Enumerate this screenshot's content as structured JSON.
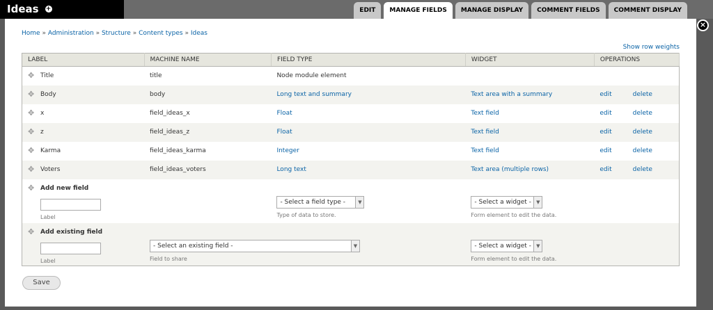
{
  "header": {
    "title": "Ideas",
    "tabs": [
      {
        "label": "EDIT",
        "active": false
      },
      {
        "label": "MANAGE FIELDS",
        "active": true
      },
      {
        "label": "MANAGE DISPLAY",
        "active": false
      },
      {
        "label": "COMMENT FIELDS",
        "active": false
      },
      {
        "label": "COMMENT DISPLAY",
        "active": false
      }
    ]
  },
  "breadcrumb": {
    "items": [
      "Home",
      "Administration",
      "Structure",
      "Content types",
      "Ideas"
    ],
    "separator": "»"
  },
  "show_row_weights": "Show row weights",
  "table": {
    "headers": [
      "LABEL",
      "MACHINE NAME",
      "FIELD TYPE",
      "WIDGET",
      "OPERATIONS"
    ],
    "rows": [
      {
        "label": "Title",
        "machine": "title",
        "type": "Node module element",
        "widget": "",
        "edit": "",
        "delete": ""
      },
      {
        "label": "Body",
        "machine": "body",
        "type": "Long text and summary",
        "widget": "Text area with a summary",
        "edit": "edit",
        "delete": "delete"
      },
      {
        "label": "x",
        "machine": "field_ideas_x",
        "type": "Float",
        "widget": "Text field",
        "edit": "edit",
        "delete": "delete"
      },
      {
        "label": "z",
        "machine": "field_ideas_z",
        "type": "Float",
        "widget": "Text field",
        "edit": "edit",
        "delete": "delete"
      },
      {
        "label": "Karma",
        "machine": "field_ideas_karma",
        "type": "Integer",
        "widget": "Text field",
        "edit": "edit",
        "delete": "delete"
      },
      {
        "label": "Voters",
        "machine": "field_ideas_voters",
        "type": "Long text",
        "widget": "Text area (multiple rows)",
        "edit": "edit",
        "delete": "delete"
      }
    ]
  },
  "add_new": {
    "title": "Add new field",
    "label_value": "",
    "label_caption": "Label",
    "type_select": "- Select a field type -",
    "type_caption": "Type of data to store.",
    "widget_select": "- Select a widget -",
    "widget_caption": "Form element to edit the data."
  },
  "add_existing": {
    "title": "Add existing field",
    "label_value": "",
    "label_caption": "Label",
    "field_select": "- Select an existing field -",
    "field_caption": "Field to share",
    "widget_select": "- Select a widget -",
    "widget_caption": "Form element to edit the data."
  },
  "save_label": "Save",
  "colors": {
    "link": "#0a63a6",
    "header_bg": "#e6e6de",
    "even_row": "#f3f3ef"
  }
}
